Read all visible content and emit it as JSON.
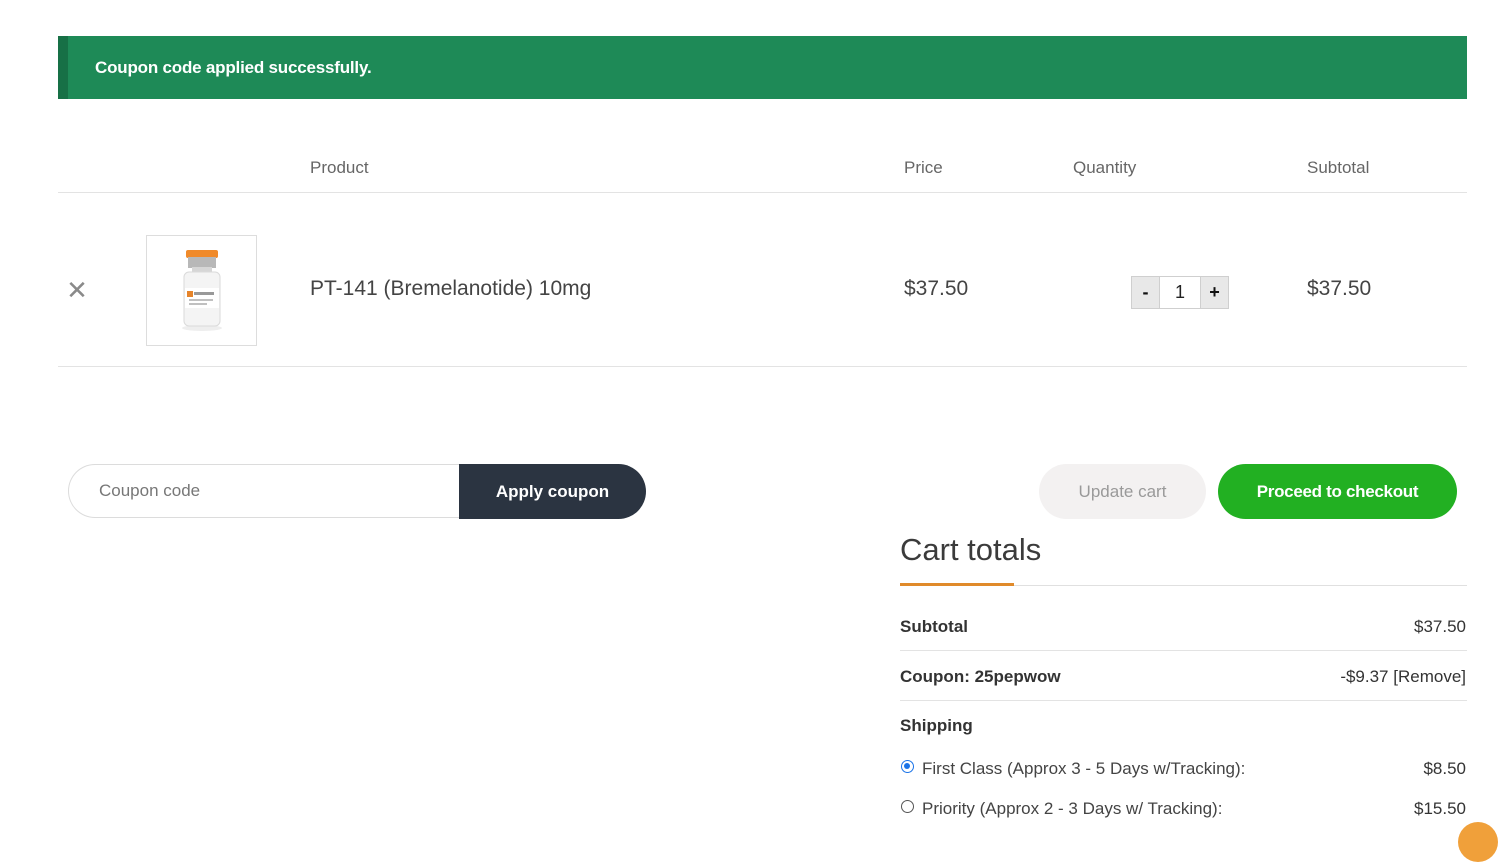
{
  "notice": {
    "text": "Coupon code applied successfully."
  },
  "table": {
    "headers": {
      "product": "Product",
      "price": "Price",
      "quantity": "Quantity",
      "subtotal": "Subtotal"
    },
    "rows": [
      {
        "remove": "✕",
        "name": "PT-141 (Bremelanotide) 10mg",
        "price": "$37.50",
        "quantity": "1",
        "subtotal": "$37.50"
      }
    ]
  },
  "quantity_controls": {
    "minus": "-",
    "plus": "+"
  },
  "coupon": {
    "placeholder": "Coupon code",
    "apply_label": "Apply coupon"
  },
  "actions": {
    "update_cart": "Update cart",
    "checkout": "Proceed to checkout"
  },
  "totals": {
    "title": "Cart totals",
    "subtotal_label": "Subtotal",
    "subtotal_value": "$37.50",
    "coupon_label": "Coupon: 25pepwow",
    "coupon_value": "-$9.37",
    "coupon_remove": "[Remove]",
    "shipping_label": "Shipping",
    "shipping_options": [
      {
        "label": "First Class (Approx 3 - 5 Days w/Tracking):",
        "price": "$8.50",
        "selected": true
      },
      {
        "label": "Priority (Approx 2 - 3 Days w/ Tracking):",
        "price": "$15.50",
        "selected": false
      }
    ]
  },
  "colors": {
    "notice_bg": "#1e8a57",
    "checkout_bg": "#22b022",
    "apply_bg": "#2b3441",
    "accent": "#e08a2a"
  },
  "icons": {
    "remove": "close-icon",
    "radio": "radio-button"
  }
}
